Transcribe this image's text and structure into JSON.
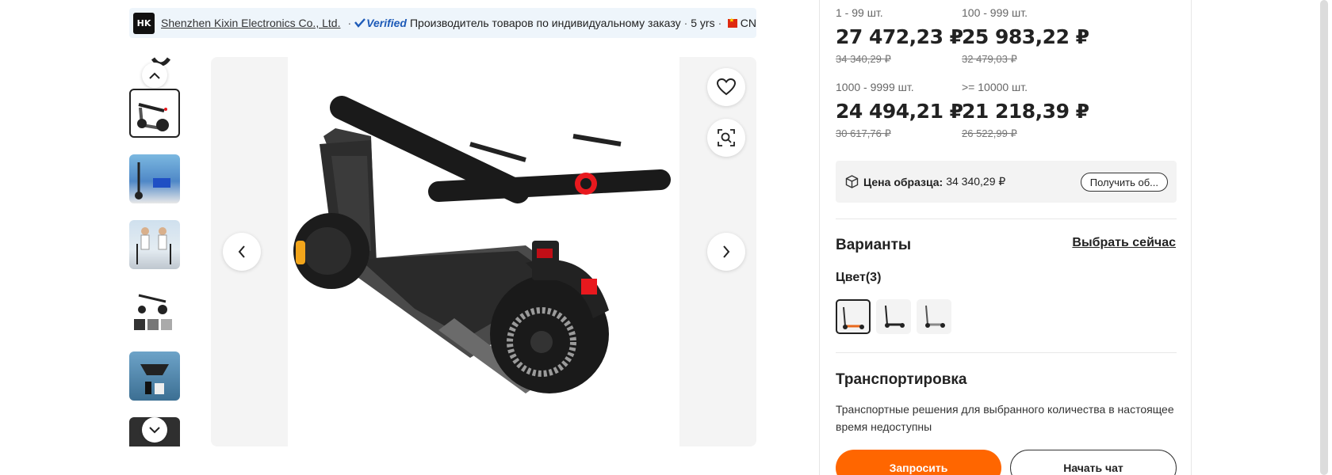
{
  "supplier": {
    "logo_text": "HK",
    "name": "Shenzhen Kixin Electronics Co., Ltd.",
    "verified_label": "Verified",
    "type": "Производитель товаров по индивидуальному заказу",
    "years": "5 yrs",
    "country": "CN"
  },
  "pricing": {
    "tiers": [
      {
        "qty": "1 - 99 шт.",
        "price": "27 472,23 ₽",
        "old": "34 340,29 ₽"
      },
      {
        "qty": "100 - 999 шт.",
        "price": "25 983,22 ₽",
        "old": "32 479,03 ₽"
      },
      {
        "qty": "1000 - 9999 шт.",
        "price": "24 494,21 ₽",
        "old": "30 617,76 ₽"
      },
      {
        "qty": ">= 10000 шт.",
        "price": "21 218,39 ₽",
        "old": "26 522,99 ₽"
      }
    ]
  },
  "sample": {
    "label": "Цена образца:",
    "price": "34 340,29 ₽",
    "button": "Получить об..."
  },
  "variants": {
    "title": "Варианты",
    "choose_now": "Выбрать сейчас",
    "color_label": "Цвет(3)"
  },
  "shipping": {
    "title": "Транспортировка",
    "text": "Транспортные решения для выбранного количества в настоящее время недоступны"
  },
  "actions": {
    "request": "Запросить",
    "chat": "Начать чат"
  },
  "colors": {
    "accent": "#ff6600",
    "verified": "#1e5bb8",
    "banner_bg": "#eef5fb",
    "red_accent": "#e8191e"
  }
}
